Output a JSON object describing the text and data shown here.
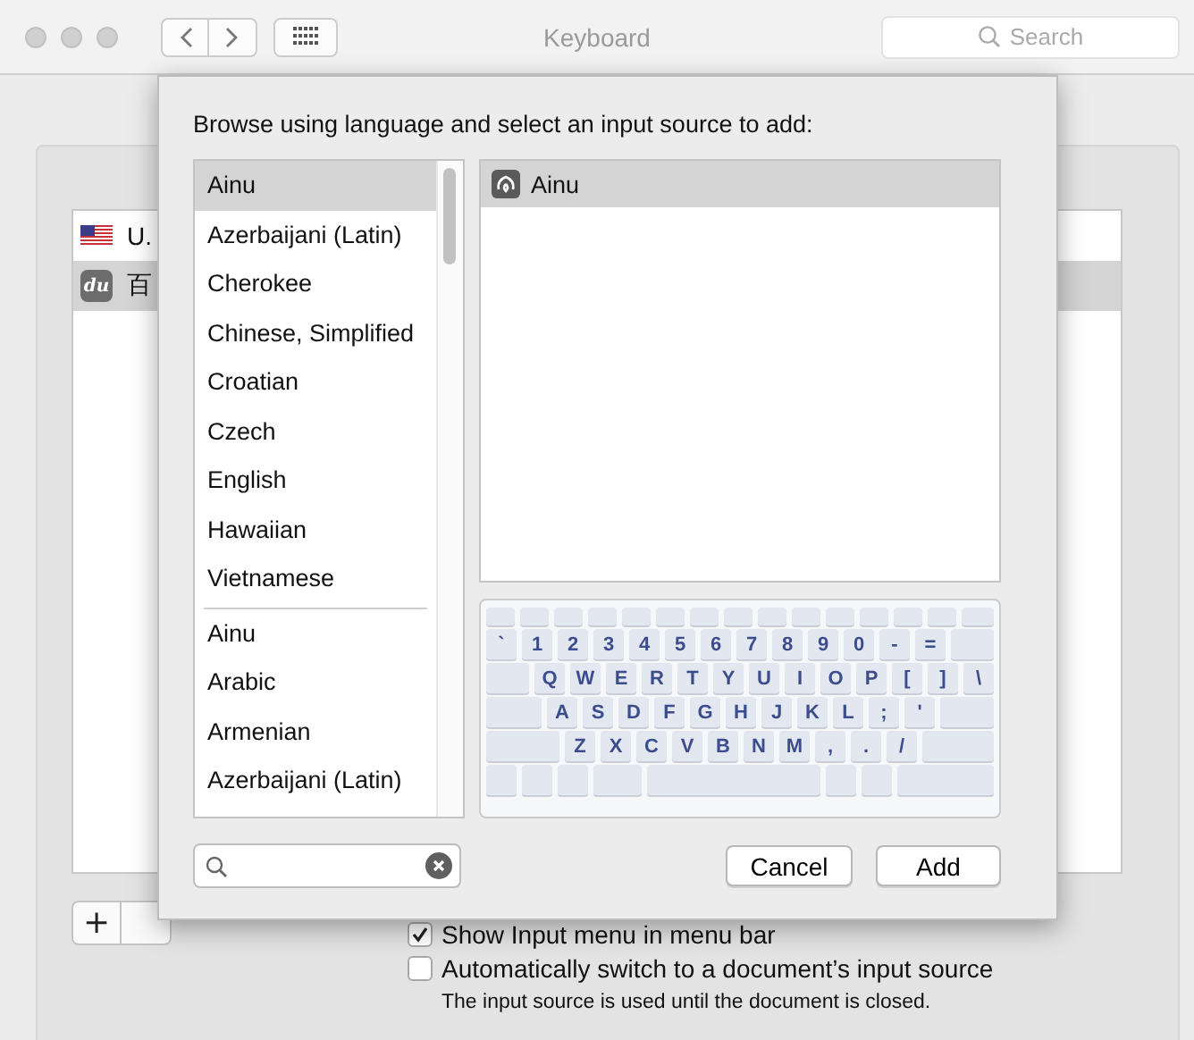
{
  "window": {
    "title": "Keyboard",
    "search_placeholder": "Search"
  },
  "input_sources": [
    {
      "label": "U.",
      "kind": "flag",
      "selected": false
    },
    {
      "label": "百",
      "kind": "badge",
      "icon_text": "du",
      "selected": true
    }
  ],
  "add_button": "+",
  "options": [
    {
      "label": "Show Input menu in menu bar",
      "checked": true
    },
    {
      "label": "Automatically switch to a document’s input source",
      "checked": false
    }
  ],
  "note": "The input source is used until the document is closed.",
  "sheet": {
    "prompt": "Browse using language and select an input source to add:",
    "language_groups": [
      [
        {
          "label": "Ainu",
          "selected": true
        },
        {
          "label": "Azerbaijani (Latin)",
          "selected": false
        },
        {
          "label": "Cherokee",
          "selected": false
        },
        {
          "label": "Chinese, Simplified",
          "selected": false
        },
        {
          "label": "Croatian",
          "selected": false
        },
        {
          "label": "Czech",
          "selected": false
        },
        {
          "label": "English",
          "selected": false
        },
        {
          "label": "Hawaiian",
          "selected": false
        },
        {
          "label": "Vietnamese",
          "selected": false
        }
      ],
      [
        {
          "label": "Ainu",
          "selected": false
        },
        {
          "label": "Arabic",
          "selected": false
        },
        {
          "label": "Armenian",
          "selected": false
        },
        {
          "label": "Azerbaijani (Latin)",
          "selected": false
        }
      ]
    ],
    "sources": [
      {
        "label": "Ainu",
        "selected": true
      }
    ],
    "keyboard_rows": [
      [
        "`",
        "1",
        "2",
        "3",
        "4",
        "5",
        "6",
        "7",
        "8",
        "9",
        "0",
        "-",
        "="
      ],
      [
        "Q",
        "W",
        "E",
        "R",
        "T",
        "Y",
        "U",
        "I",
        "O",
        "P",
        "[",
        "]",
        "\\"
      ],
      [
        "A",
        "S",
        "D",
        "F",
        "G",
        "H",
        "J",
        "K",
        "L",
        ";",
        "'"
      ],
      [
        "Z",
        "X",
        "C",
        "V",
        "B",
        "N",
        "M",
        ",",
        ".",
        "/"
      ]
    ],
    "buttons": [
      {
        "label": "Cancel",
        "kind": "secondary"
      },
      {
        "label": "Add",
        "kind": "default"
      }
    ]
  }
}
